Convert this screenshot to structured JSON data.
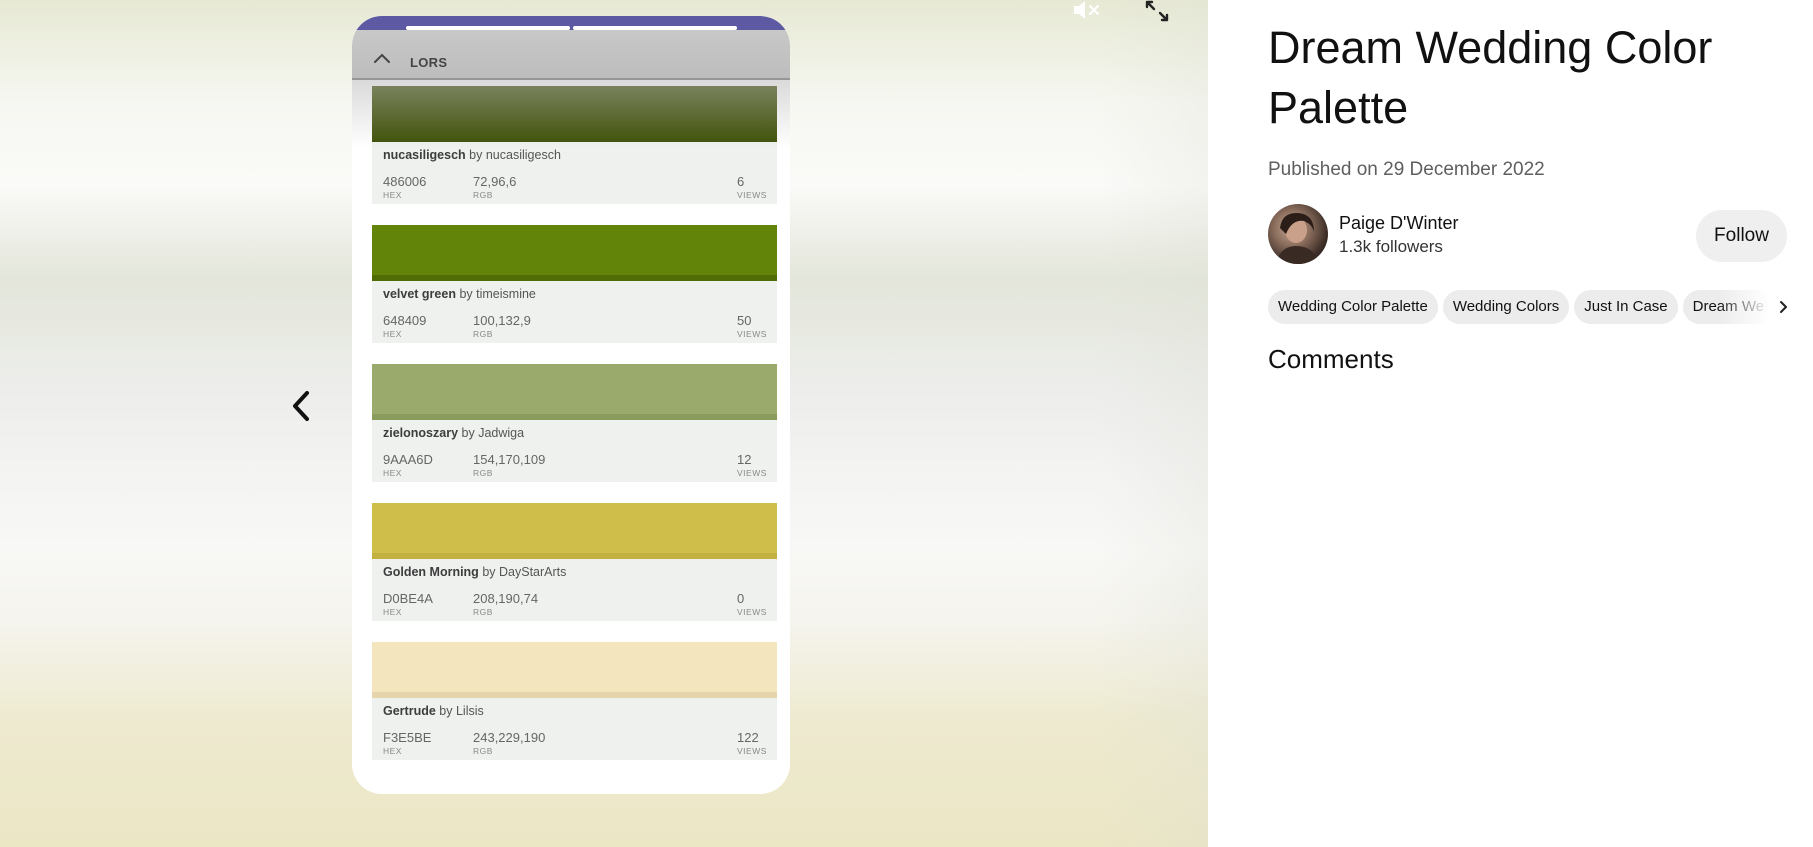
{
  "pin": {
    "title": "Dream Wedding Color Palette",
    "published": "Published on 29 December 2022",
    "author": {
      "name": "Paige D'Winter",
      "followers": "1.3k followers"
    },
    "follow_label": "Follow",
    "tags": [
      "Wedding Color Palette",
      "Wedding Colors",
      "Just In Case",
      "Dream We"
    ],
    "comments_heading": "Comments"
  },
  "media": {
    "section_label": "LORS",
    "colors": [
      {
        "name": "nucasiligesch",
        "by": "by",
        "author": "nucasiligesch",
        "hex": "486006",
        "rgb": "72,96,6",
        "views": "6",
        "swatch": "#3d4f05"
      },
      {
        "name": "velvet green",
        "by": "by",
        "author": "timeismine",
        "hex": "648409",
        "rgb": "100,132,9",
        "views": "50",
        "swatch": "#628409"
      },
      {
        "name": "zielonoszary",
        "by": "by",
        "author": "Jadwiga",
        "hex": "9AAA6D",
        "rgb": "154,170,109",
        "views": "12",
        "swatch": "#9aaa6d"
      },
      {
        "name": "Golden Morning",
        "by": "by",
        "author": "DayStarArts",
        "hex": "D0BE4A",
        "rgb": "208,190,74",
        "views": "0",
        "swatch": "#d0be4a"
      },
      {
        "name": "Gertrude",
        "by": "by",
        "author": "Lilsis",
        "hex": "F3E5BE",
        "rgb": "243,229,190",
        "views": "122",
        "swatch": "#f3e5be"
      }
    ],
    "labels": {
      "hex": "HEX",
      "rgb": "RGB",
      "views": "VIEWS"
    }
  },
  "icons": {
    "mute": "mute-icon",
    "expand": "expand-icon",
    "prev": "chevron-left-icon",
    "collapse": "chevron-up-icon",
    "tags_next": "chevron-right-icon"
  }
}
